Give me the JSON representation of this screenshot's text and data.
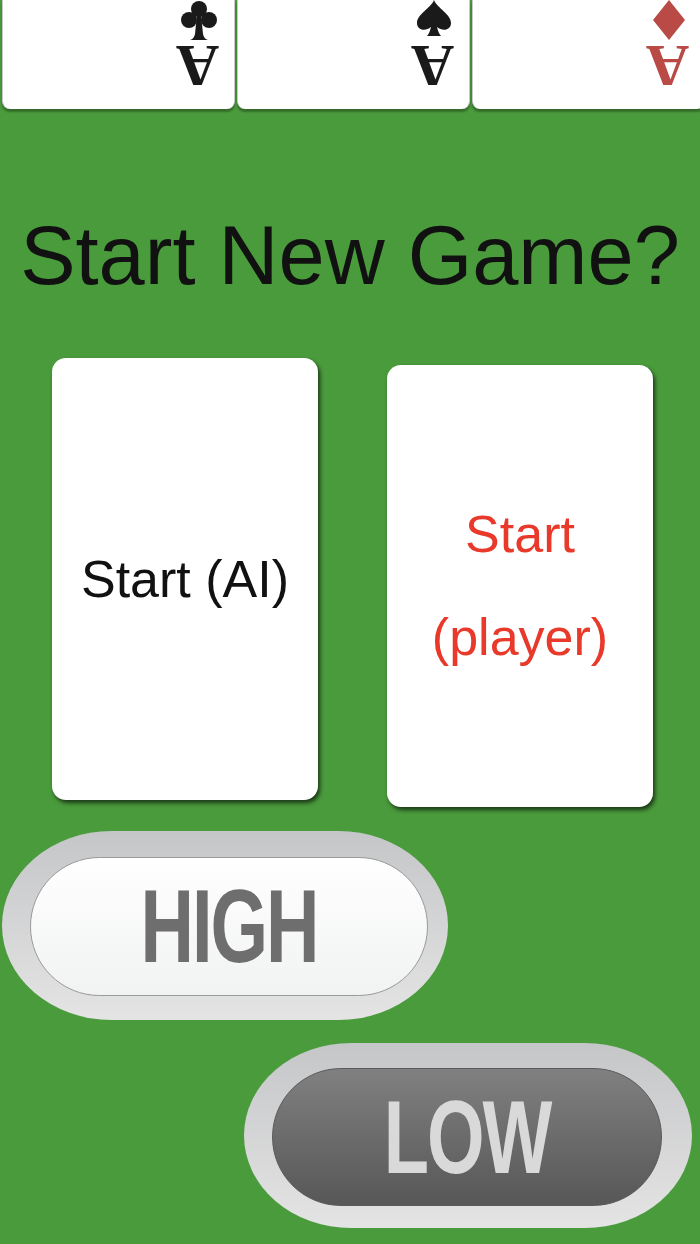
{
  "cards": [
    {
      "rank": "A",
      "kind": "clubs",
      "color": "#1a1a1a"
    },
    {
      "rank": "A",
      "kind": "spades",
      "color": "#1a1a1a"
    },
    {
      "rank": "A",
      "kind": "diamonds",
      "color": "#b94a45"
    }
  ],
  "title": "Start New Game?",
  "start_options": [
    {
      "label": "Start (AI)",
      "color": "#111111"
    },
    {
      "label": "Start (player)",
      "color": "#e8392a"
    }
  ],
  "guess_buttons": [
    {
      "label": "HIGH",
      "selected": false
    },
    {
      "label": "LOW",
      "selected": true
    }
  ]
}
